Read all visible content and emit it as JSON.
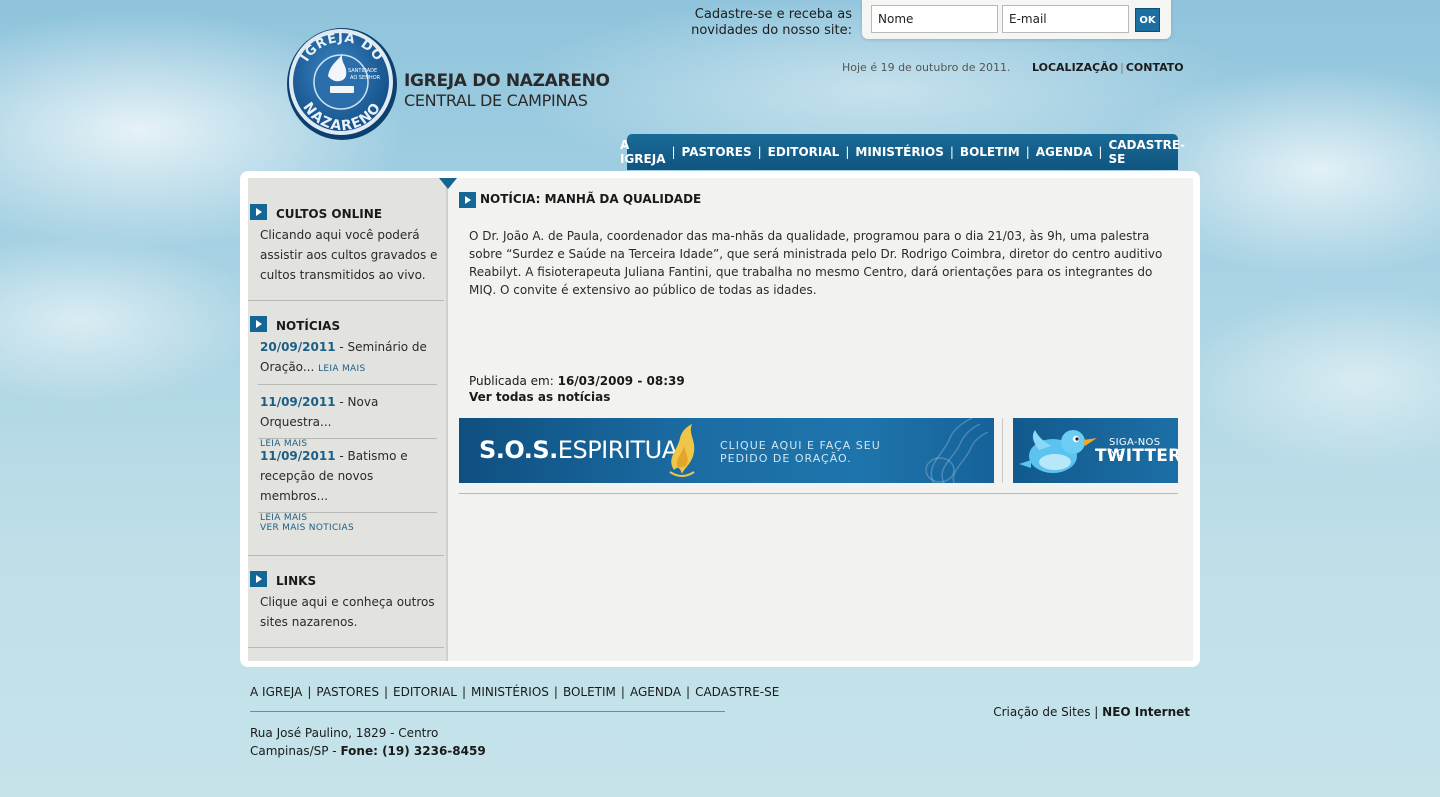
{
  "newsletter": {
    "line1": "Cadastre-se e receba as",
    "line2": "novidades do nosso site:",
    "name_placeholder": "Nome",
    "email_placeholder": "E-mail",
    "submit_label": "OK"
  },
  "logo": {
    "title": "IGREJA DO NAZARENO",
    "subtitle": "CENTRAL DE CAMPINAS",
    "seal_top_text": "IGREJA DO",
    "seal_bottom_text": "NAZARENO",
    "seal_center_text_1": "SANTIDADE",
    "seal_center_text_2": "AO SENHOR"
  },
  "header": {
    "date_text": "Hoje é 19 de outubro de 2011.",
    "links": [
      "LOCALIZAÇÃO",
      "CONTATO"
    ],
    "link_separator": "|"
  },
  "main_nav": {
    "items": [
      "A IGREJA",
      "PASTORES",
      "EDITORIAL",
      "MINISTÉRIOS",
      "BOLETIM",
      "AGENDA",
      "CADASTRE-SE"
    ],
    "separator": "|"
  },
  "sidebar": {
    "cultos": {
      "title": "CULTOS ONLINE",
      "text": "Clicando aqui você poderá assistir aos cultos gravados e cultos transmitidos ao vivo."
    },
    "noticias": {
      "title": "NOTÍCIAS",
      "items": [
        {
          "date": "20/09/2011",
          "text": " - Seminário de Oração...",
          "more": "LEIA MAIS"
        },
        {
          "date": "11/09/2011",
          "text": " - Nova Orquestra...",
          "more": "LEIA MAIS"
        },
        {
          "date": "11/09/2011",
          "text": " - Batismo e recepção de novos membros...",
          "more": "LEIA MAIS"
        }
      ],
      "see_more": "VER MAIS NOTICIAS"
    },
    "links": {
      "title": "LINKS",
      "text": "Clique aqui e conheça outros sites nazarenos."
    }
  },
  "article": {
    "heading": "NOTÍCIA: MANHÃ DA QUALIDADE",
    "body": "O Dr. João A. de Paula, coordenador das ma-nhãs da qualidade, programou para o dia 21/03, às 9h, uma palestra sobre “Surdez e Saúde na Terceira Idade”, que será ministrada pelo Dr. Rodrigo Coimbra, diretor do centro auditivo Reabilyt. A fisioterapeuta Juliana Fantini, que trabalha no mesmo Centro, dará orientações para os integrantes do MIQ. O convite é extensivo ao público de todas as idades.",
    "published_label": "Publicada em: ",
    "published_value": "16/03/2009 - 08:39",
    "see_all": "Ver todas as notícias"
  },
  "banners": {
    "sos_title_bold": "S.O.S.",
    "sos_title_rest": "ESPIRITUAL",
    "sos_cta_line1": "CLIQUE AQUI E FAÇA SEU",
    "sos_cta_line2": "PEDIDO DE ORAÇÃO.",
    "twitter_line1": "SIGA-NOS NO",
    "twitter_line2": "TWITTER"
  },
  "footer": {
    "nav": [
      "A IGREJA",
      "PASTORES",
      "EDITORIAL",
      "MINISTÉRIOS",
      "BOLETIM",
      "AGENDA",
      "CADASTRE-SE"
    ],
    "address_line1": "Rua José Paulino, 1829 - Centro",
    "address_city": "Campinas/SP - ",
    "address_phone": "Fone: (19) 3236-8459",
    "credit_text": "Criação de Sites",
    "credit_separator": "|",
    "credit_company": "NEO Internet"
  },
  "colors": {
    "accent": "#136796",
    "nav_bg": "#0f557f",
    "news_date": "#1c5f86",
    "sidebar_bg": "#e2e2de",
    "content_bg": "#f2f2f0"
  },
  "icons": [
    "arrow-bullet-icon",
    "flame-icon",
    "twitter-bird-icon"
  ]
}
